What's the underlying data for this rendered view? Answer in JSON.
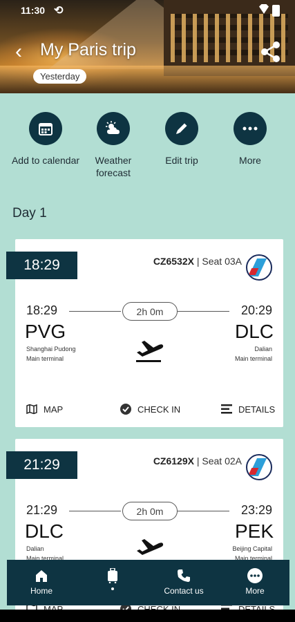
{
  "status_bar": {
    "time": "11:30"
  },
  "header": {
    "title": "My Paris trip",
    "date_chip": "Yesterday"
  },
  "actions": [
    {
      "label": "Add to calendar",
      "icon": "calendar-icon"
    },
    {
      "label": "Weather forecast",
      "icon": "weather-icon"
    },
    {
      "label": "Edit trip",
      "icon": "pencil-icon"
    },
    {
      "label": "More",
      "icon": "more-dots-icon"
    }
  ],
  "day_label": "Day 1",
  "flights": [
    {
      "tag_time": "18:29",
      "flight_no": "CZ6532X",
      "seat": "| Seat 03A",
      "dep_time": "18:29",
      "arr_time": "20:29",
      "duration": "2h 0m",
      "dep_code": "PVG",
      "arr_code": "DLC",
      "dep_airport": "Shanghai Pudong",
      "dep_terminal": "Main terminal",
      "arr_airport": "Dalian",
      "arr_terminal": "Main terminal",
      "map_label": "MAP",
      "checkin_label": "CHECK IN",
      "details_label": "DETAILS"
    },
    {
      "tag_time": "21:29",
      "flight_no": "CZ6129X",
      "seat": "| Seat 02A",
      "dep_time": "21:29",
      "arr_time": "23:29",
      "duration": "2h 0m",
      "dep_code": "DLC",
      "arr_code": "PEK",
      "dep_airport": "Dalian",
      "dep_terminal": "Main terminal",
      "arr_airport": "Beijing Capital",
      "arr_terminal": "Main terminal",
      "map_label": "MAP",
      "checkin_label": "CHECK IN",
      "details_label": "DETAILS"
    }
  ],
  "bottom_nav": [
    {
      "label": "Home",
      "icon": "home-icon"
    },
    {
      "label": "",
      "icon": "luggage-icon"
    },
    {
      "label": "Contact us",
      "icon": "phone-icon"
    },
    {
      "label": "More",
      "icon": "more-circle-icon"
    }
  ],
  "colors": {
    "background": "#b2ded3",
    "primary": "#0e3442",
    "card": "#ffffff"
  }
}
